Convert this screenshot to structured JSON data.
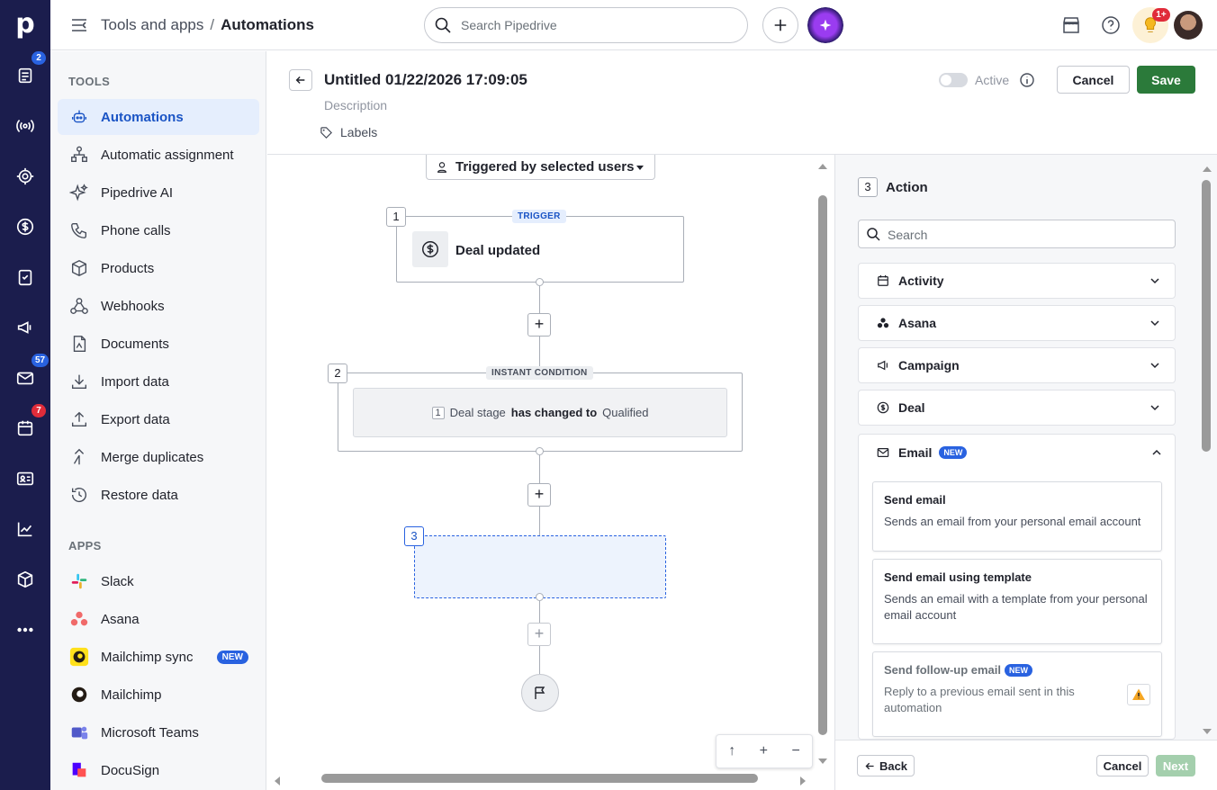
{
  "rail": {
    "badges": {
      "leads": "2",
      "mail": "57",
      "calendar": "7"
    },
    "items": [
      "leads-icon",
      "radio-icon",
      "target-icon",
      "dollar-icon",
      "clipboard-icon",
      "megaphone-icon",
      "mail-icon",
      "calendar-icon",
      "contacts-icon",
      "chart-icon",
      "box-icon",
      "more-icon"
    ]
  },
  "header": {
    "breadcrumb_parent": "Tools and apps",
    "breadcrumb_separator": "/",
    "breadcrumb_current": "Automations",
    "search_placeholder": "Search Pipedrive",
    "notification_badge": "1+"
  },
  "sidebar": {
    "tools_title": "TOOLS",
    "tools": [
      {
        "label": "Automations",
        "active": true
      },
      {
        "label": "Automatic assignment"
      },
      {
        "label": "Pipedrive AI"
      },
      {
        "label": "Phone calls"
      },
      {
        "label": "Products"
      },
      {
        "label": "Webhooks"
      },
      {
        "label": "Documents"
      },
      {
        "label": "Import data"
      },
      {
        "label": "Export data"
      },
      {
        "label": "Merge duplicates"
      },
      {
        "label": "Restore data"
      }
    ],
    "apps_title": "APPS",
    "apps": [
      {
        "label": "Slack"
      },
      {
        "label": "Asana"
      },
      {
        "label": "Mailchimp sync",
        "badge": "NEW"
      },
      {
        "label": "Mailchimp"
      },
      {
        "label": "Microsoft Teams"
      },
      {
        "label": "DocuSign"
      }
    ]
  },
  "editor": {
    "title": "Untitled 01/22/2026 17:09:05",
    "description_placeholder": "Description",
    "labels": "Labels",
    "active_label": "Active",
    "active": false,
    "cancel": "Cancel",
    "save": "Save"
  },
  "canvas": {
    "trigger_select": "Triggered by selected users",
    "node1": {
      "num": "1",
      "tag": "TRIGGER",
      "label": "Deal updated"
    },
    "node2": {
      "num": "2",
      "tag": "INSTANT CONDITION",
      "cond_num": "1",
      "field": "Deal stage",
      "operator": "has changed to",
      "value": "Qualified"
    },
    "node3": {
      "num": "3"
    },
    "zoom_controls": [
      "↑",
      "+",
      "−"
    ]
  },
  "panel": {
    "step_num": "3",
    "title": "Action",
    "search_placeholder": "Search",
    "groups": [
      "Activity",
      "Asana",
      "Campaign",
      "Deal"
    ],
    "email_group": {
      "label": "Email",
      "badge": "NEW"
    },
    "cards": [
      {
        "title": "Send email",
        "desc": "Sends an email from your personal email account"
      },
      {
        "title": "Send email using template",
        "desc": "Sends an email with a template from your personal email account"
      },
      {
        "title": "Send follow-up email",
        "badge": "NEW",
        "desc": "Reply to a previous email sent in this automation",
        "warning": true
      }
    ],
    "footer": {
      "back": "Back",
      "cancel": "Cancel",
      "next": "Next"
    }
  },
  "colors": {
    "rail": "#1b1d4d",
    "accent": "#1a54c5",
    "save": "#2b7a3a",
    "new_badge": "#2962e0",
    "notif": "#e02c3a"
  }
}
